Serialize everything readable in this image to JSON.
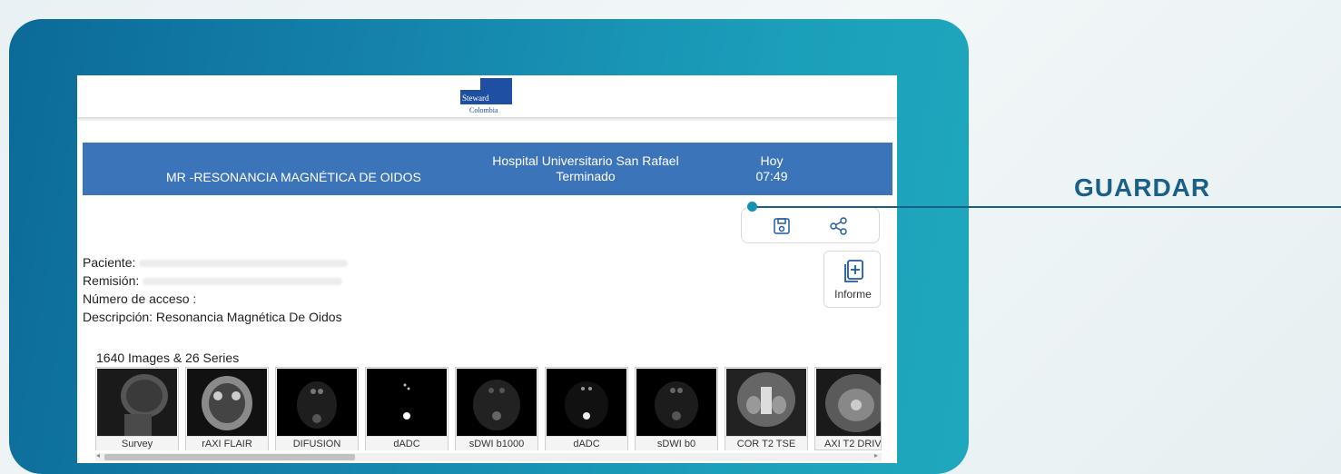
{
  "callout": {
    "label": "GUARDAR"
  },
  "header": {
    "logo_line1": "Steward",
    "logo_line2": "Colombia"
  },
  "study": {
    "description": "MR -RESONANCIA MAGNÉTICA DE OIDOS",
    "hospital": "Hospital Universitario San Rafael",
    "status": "Terminado",
    "date": "Hoy",
    "time": "07:49",
    "bar_color": "#3c74b9"
  },
  "actions": {
    "save_icon": "floppy-disk-icon",
    "share_icon": "share-icon",
    "informe_label": "Informe",
    "informe_icon": "add-document-icon"
  },
  "patient": {
    "paciente_label": "Paciente:",
    "remision_label": "Remisión:",
    "acceso_label": "Número de acceso :",
    "descripcion_label": "Descripción:",
    "descripcion_value": "Resonancia Magnética De Oidos"
  },
  "series_count": "1640 Images & 26 Series",
  "series": [
    {
      "label": "Survey"
    },
    {
      "label": "rAXI FLAIR"
    },
    {
      "label": "DIFUSION"
    },
    {
      "label": "dADC"
    },
    {
      "label": "sDWI b1000"
    },
    {
      "label": "dADC"
    },
    {
      "label": "sDWI b0"
    },
    {
      "label": "COR T2 TSE"
    },
    {
      "label": "AXI T2 DRIVE"
    }
  ],
  "colors": {
    "accent": "#1a5f86",
    "frame": "#1585ad"
  }
}
